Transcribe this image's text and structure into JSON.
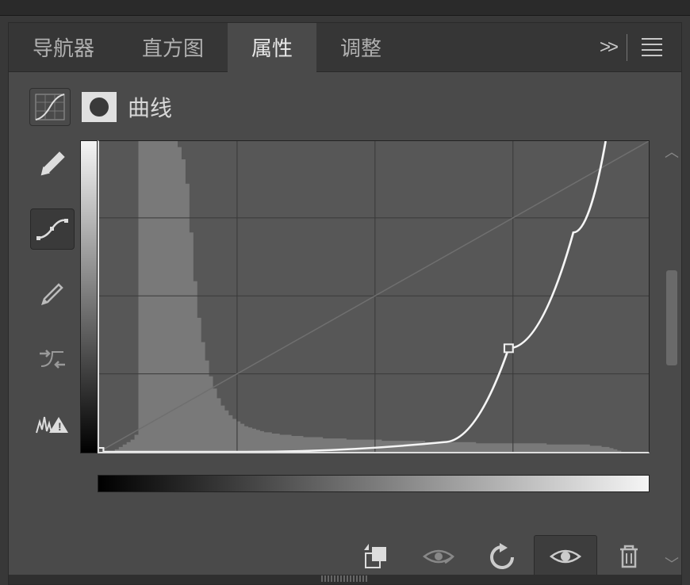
{
  "tabs": {
    "navigator": "导航器",
    "histogram": "直方图",
    "properties": "属性",
    "adjustments": "调整",
    "active": "properties"
  },
  "adjustment": {
    "type_label": "曲线"
  },
  "icons": {
    "curves": "curves-icon",
    "mask": "mask-icon",
    "eyedropper": "eyedropper-icon",
    "point_curve": "point-curve-icon",
    "pencil": "pencil-icon",
    "auto": "auto-icon",
    "clip_warn": "clip-warning-icon",
    "clip_layer": "clip-to-layer-icon",
    "view_prev": "view-previous-icon",
    "reset": "reset-icon",
    "visibility": "visibility-icon",
    "delete": "delete-icon",
    "expand": ">>",
    "menu": "menu-icon"
  },
  "chart_data": {
    "type": "line",
    "title": "",
    "xlabel": "",
    "ylabel": "",
    "xlim": [
      0,
      255
    ],
    "ylim": [
      0,
      255
    ],
    "grid": [
      64,
      128,
      192
    ],
    "curve_points": [
      {
        "in": 0,
        "out": 0
      },
      {
        "in": 68,
        "out": 0
      },
      {
        "in": 160,
        "out": 8
      },
      {
        "in": 190,
        "out": 85
      },
      {
        "in": 220,
        "out": 180
      },
      {
        "in": 235,
        "out": 255
      }
    ],
    "control_point": {
      "in": 190,
      "out": 85
    },
    "histogram": [
      0,
      0,
      0,
      0,
      2,
      4,
      6,
      8,
      10,
      14,
      255,
      255,
      255,
      255,
      255,
      255,
      255,
      255,
      255,
      255,
      250,
      240,
      220,
      180,
      140,
      110,
      90,
      75,
      62,
      52,
      44,
      38,
      34,
      30,
      27,
      25,
      23,
      21,
      20,
      19,
      18,
      17,
      16,
      16,
      15,
      15,
      14,
      14,
      14,
      13,
      13,
      13,
      12,
      12,
      12,
      12,
      12,
      11,
      11,
      11,
      11,
      11,
      11,
      10,
      10,
      10,
      10,
      10,
      10,
      10,
      10,
      10,
      9,
      9,
      9,
      9,
      9,
      9,
      9,
      9,
      9,
      9,
      9,
      8,
      8,
      8,
      8,
      8,
      8,
      8,
      8,
      8,
      8,
      8,
      8,
      8,
      7,
      7,
      7,
      7,
      7,
      7,
      7,
      7,
      7,
      7,
      7,
      7,
      7,
      7,
      7,
      7,
      7,
      7,
      6,
      6,
      6,
      6,
      6,
      6,
      6,
      6,
      6,
      6,
      6,
      5,
      5,
      5,
      4,
      4,
      3,
      2,
      1,
      0,
      0,
      0,
      0,
      0,
      0,
      0
    ]
  }
}
